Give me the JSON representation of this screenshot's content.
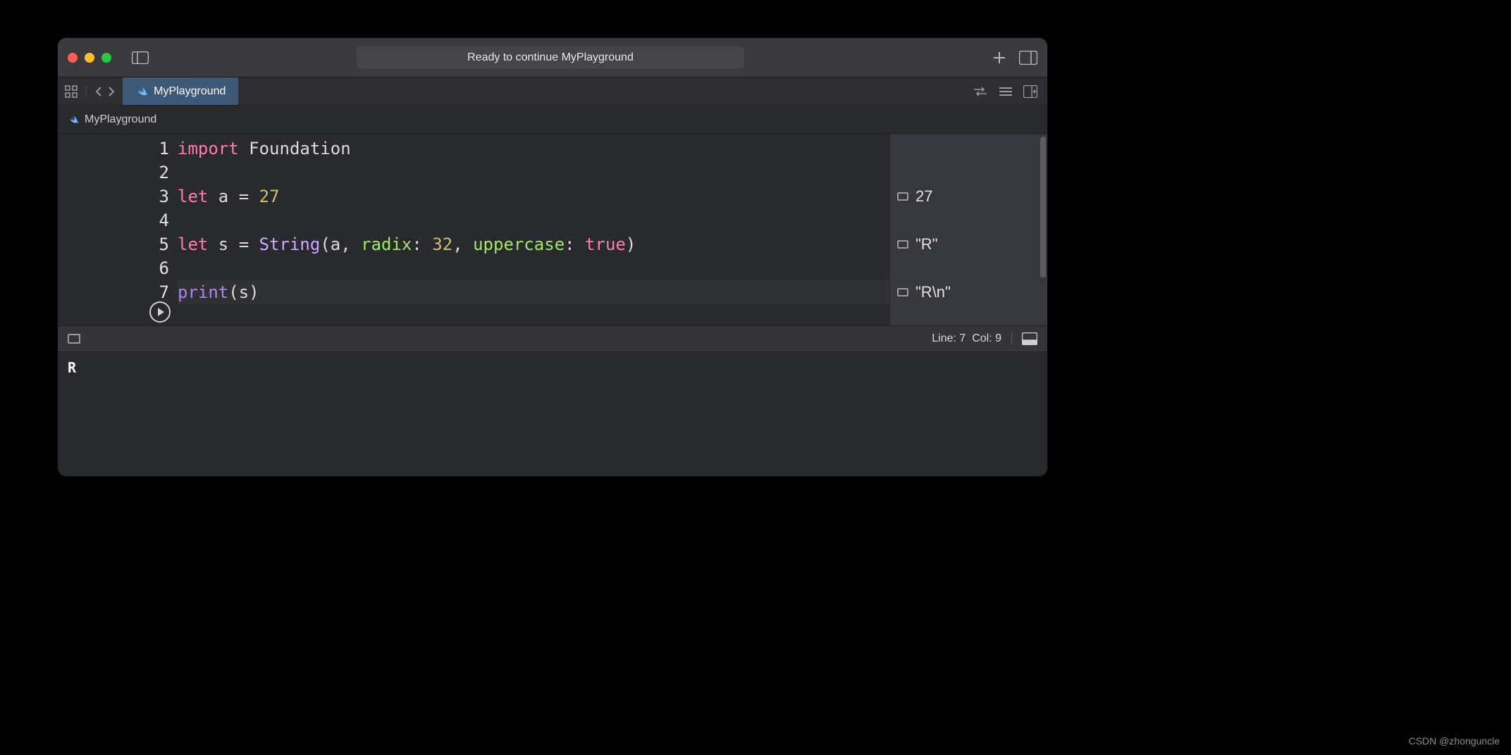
{
  "titlebar": {
    "status": "Ready to continue MyPlayground"
  },
  "tab": {
    "name": "MyPlayground"
  },
  "breadcrumb": {
    "name": "MyPlayground"
  },
  "code": {
    "lines": [
      {
        "n": "1",
        "tokens": [
          {
            "t": "import",
            "c": "kw"
          },
          {
            "t": " ",
            "c": "punc"
          },
          {
            "t": "Foundation",
            "c": "ident"
          }
        ]
      },
      {
        "n": "2",
        "tokens": []
      },
      {
        "n": "3",
        "tokens": [
          {
            "t": "let",
            "c": "kw"
          },
          {
            "t": " a ",
            "c": "ident"
          },
          {
            "t": "=",
            "c": "punc"
          },
          {
            "t": " ",
            "c": "punc"
          },
          {
            "t": "27",
            "c": "num"
          }
        ]
      },
      {
        "n": "4",
        "tokens": []
      },
      {
        "n": "5",
        "tokens": [
          {
            "t": "let",
            "c": "kw"
          },
          {
            "t": " s ",
            "c": "ident"
          },
          {
            "t": "=",
            "c": "punc"
          },
          {
            "t": " ",
            "c": "punc"
          },
          {
            "t": "String",
            "c": "tp"
          },
          {
            "t": "(a, ",
            "c": "punc"
          },
          {
            "t": "radix",
            "c": "param"
          },
          {
            "t": ": ",
            "c": "punc"
          },
          {
            "t": "32",
            "c": "num"
          },
          {
            "t": ", ",
            "c": "punc"
          },
          {
            "t": "uppercase",
            "c": "param"
          },
          {
            "t": ": ",
            "c": "punc"
          },
          {
            "t": "true",
            "c": "bool"
          },
          {
            "t": ")",
            "c": "punc"
          }
        ]
      },
      {
        "n": "6",
        "tokens": []
      },
      {
        "n": "7",
        "tokens": [
          {
            "t": "print",
            "c": "fn"
          },
          {
            "t": "(s)",
            "c": "punc"
          }
        ]
      }
    ],
    "current_line_index": 6
  },
  "results": [
    {
      "row": 2,
      "value": "27"
    },
    {
      "row": 4,
      "value": "\"R\""
    },
    {
      "row": 6,
      "value": "\"R\\n\""
    }
  ],
  "cursor": {
    "line": "7",
    "col": "9",
    "label_line": "Line:",
    "label_col": "Col:"
  },
  "console": {
    "output": "R"
  },
  "watermark": "CSDN @zhonguncle"
}
